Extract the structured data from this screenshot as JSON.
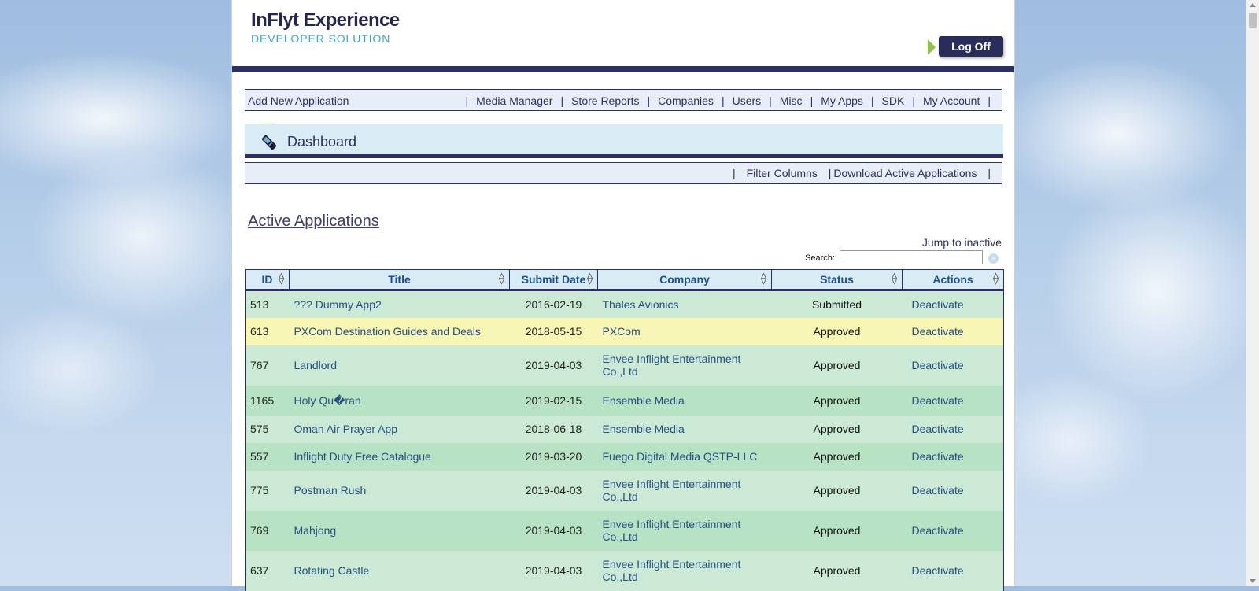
{
  "header": {
    "logo_title": "InFlyt Experience",
    "logo_subtitle": "DEVELOPER SOLUTION",
    "logoff_label": "Log Off"
  },
  "top_nav": {
    "add_label": "Add New Application",
    "items": [
      {
        "label": "Media Manager"
      },
      {
        "label": "Store Reports"
      },
      {
        "label": "Companies"
      },
      {
        "label": "Users"
      },
      {
        "label": "Misc"
      },
      {
        "label": "My Apps"
      },
      {
        "label": "SDK"
      },
      {
        "label": "My Account"
      }
    ]
  },
  "dashboard": {
    "title": "Dashboard",
    "icon": "phone-icon"
  },
  "sub_nav": {
    "filter_label": "Filter Columns",
    "download_label": "Download Active Applications"
  },
  "section": {
    "title": "Active Applications",
    "jump_label": "Jump to inactive",
    "search_label": "Search:",
    "search_value": ""
  },
  "table": {
    "columns": [
      "ID",
      "Title",
      "Submit Date",
      "Company",
      "Status",
      "Actions"
    ],
    "rows": [
      {
        "id": "513",
        "title": "??? Dummy App2",
        "date": "2016-02-19",
        "company": "Thales Avionics",
        "status": "Submitted",
        "action": "Deactivate",
        "highlight": false
      },
      {
        "id": "613",
        "title": "PXCom Destination Guides and Deals",
        "date": "2018-05-15",
        "company": "PXCom",
        "status": "Approved",
        "action": "Deactivate",
        "highlight": true
      },
      {
        "id": "767",
        "title": "Landlord",
        "date": "2019-04-03",
        "company": "Envee Inflight Entertainment Co.,Ltd",
        "status": "Approved",
        "action": "Deactivate",
        "highlight": false
      },
      {
        "id": "1165",
        "title": "Holy Qu�ran",
        "date": "2019-02-15",
        "company": "Ensemble Media",
        "status": "Approved",
        "action": "Deactivate",
        "highlight": false
      },
      {
        "id": "575",
        "title": "Oman Air Prayer App",
        "date": "2018-06-18",
        "company": "Ensemble Media",
        "status": "Approved",
        "action": "Deactivate",
        "highlight": false
      },
      {
        "id": "557",
        "title": "Inflight Duty Free Catalogue",
        "date": "2019-03-20",
        "company": "Fuego Digital Media QSTP-LLC",
        "status": "Approved",
        "action": "Deactivate",
        "highlight": false
      },
      {
        "id": "775",
        "title": "Postman Rush",
        "date": "2019-04-03",
        "company": "Envee Inflight Entertainment Co.,Ltd",
        "status": "Approved",
        "action": "Deactivate",
        "highlight": false
      },
      {
        "id": "769",
        "title": "Mahjong",
        "date": "2019-04-03",
        "company": "Envee Inflight Entertainment Co.,Ltd",
        "status": "Approved",
        "action": "Deactivate",
        "highlight": false
      },
      {
        "id": "637",
        "title": "Rotating Castle",
        "date": "2019-04-03",
        "company": "Envee Inflight Entertainment Co.,Ltd",
        "status": "Approved",
        "action": "Deactivate",
        "highlight": false
      }
    ]
  },
  "colors": {
    "navy": "#2d2f5e",
    "accent_green": "#8cc63e",
    "row_light": "#cbe9d4",
    "row_dark": "#b7e3c4",
    "row_highlight": "#f8f6b4"
  }
}
